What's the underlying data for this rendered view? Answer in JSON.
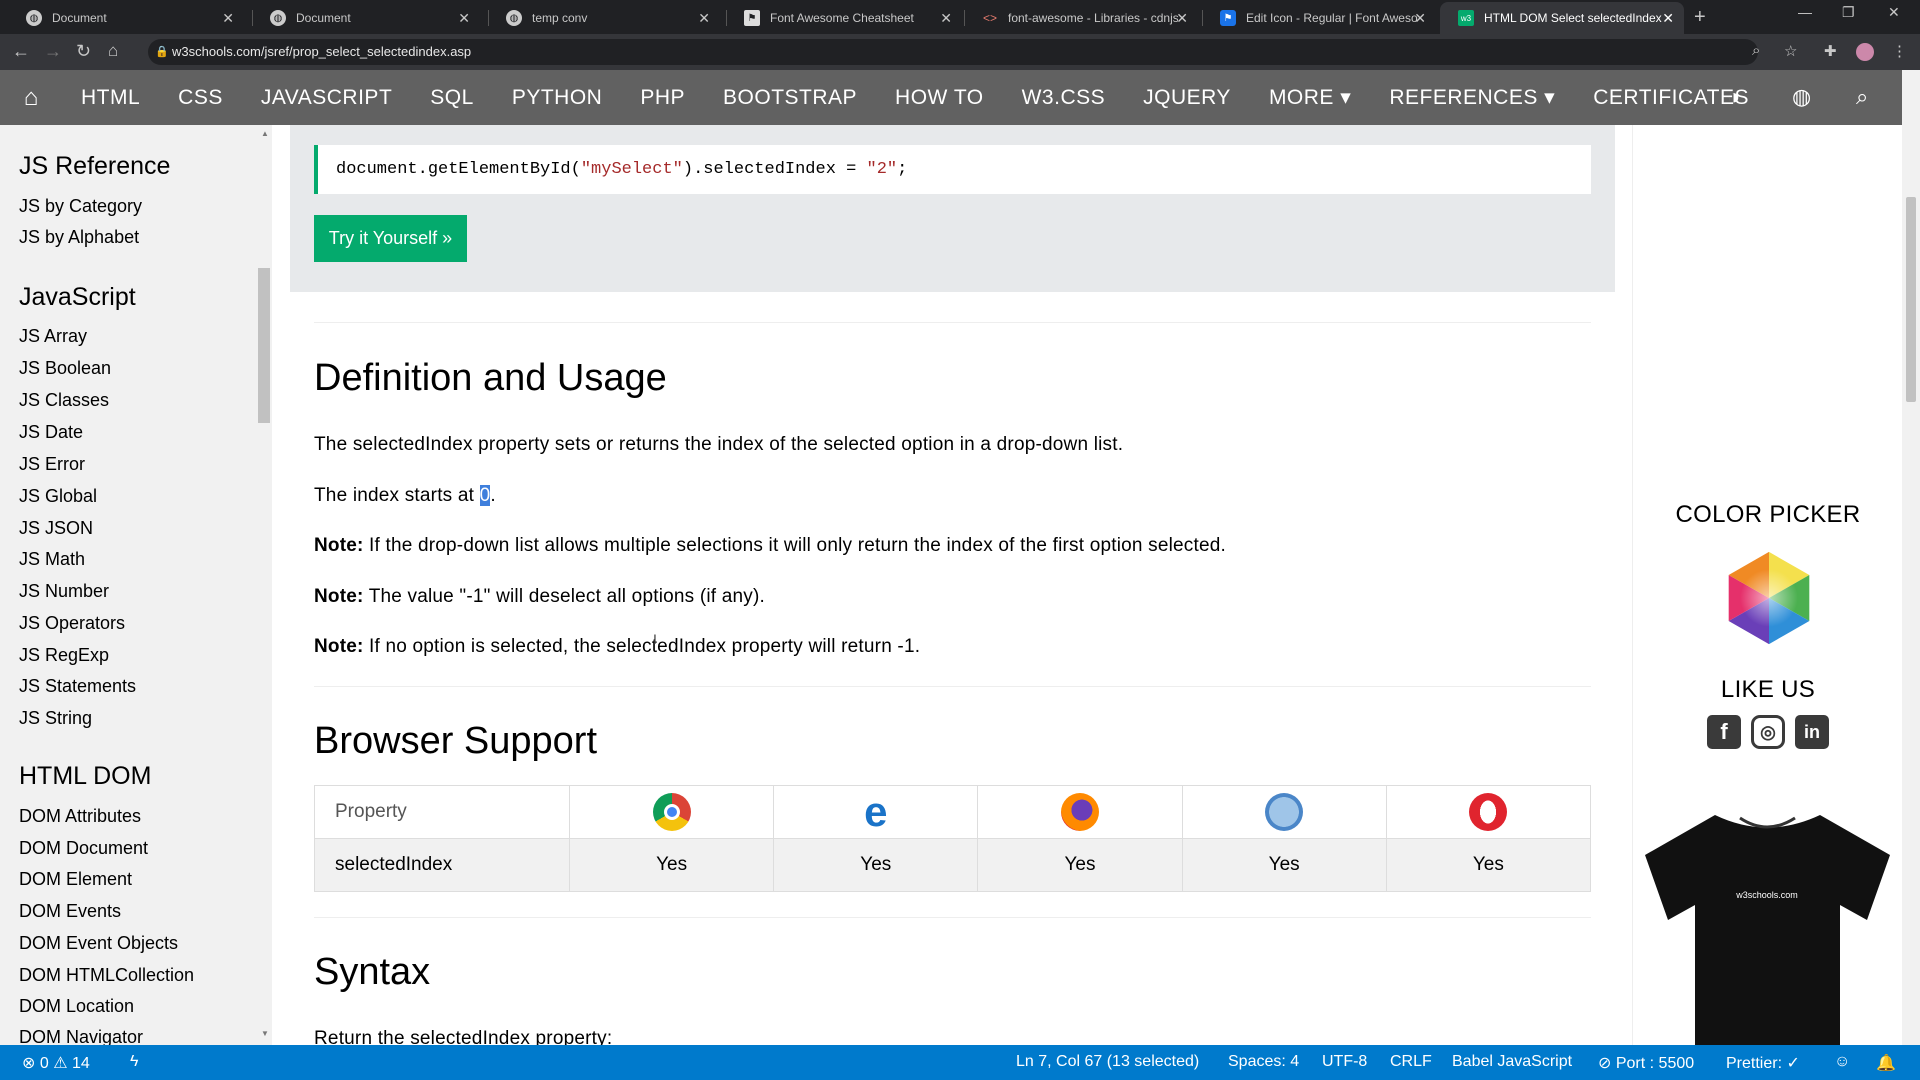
{
  "browser": {
    "tabs": [
      {
        "title": "Document",
        "active": false
      },
      {
        "title": "Document",
        "active": false
      },
      {
        "title": "temp conv",
        "active": false
      },
      {
        "title": "Font Awesome Cheatsheet",
        "active": false
      },
      {
        "title": "font-awesome - Libraries - cdnjs",
        "active": false
      },
      {
        "title": "Edit Icon - Regular | Font Awesome",
        "active": false
      },
      {
        "title": "HTML DOM Select selectedIndex",
        "active": true
      }
    ],
    "url": "w3schools.com/jsref/prop_select_selectedindex.asp"
  },
  "topnav": {
    "items": [
      "HTML",
      "CSS",
      "JAVASCRIPT",
      "SQL",
      "PYTHON",
      "PHP",
      "BOOTSTRAP",
      "HOW TO",
      "W3.CSS",
      "JQUERY",
      "MORE ▾",
      "REFERENCES ▾",
      "CERTIFICATES"
    ]
  },
  "sidebar": {
    "sections": [
      {
        "heading": "JS Reference",
        "items": [
          "JS by Category",
          "JS by Alphabet"
        ]
      },
      {
        "heading": "JavaScript",
        "items": [
          "JS Array",
          "JS Boolean",
          "JS Classes",
          "JS Date",
          "JS Error",
          "JS Global",
          "JS JSON",
          "JS Math",
          "JS Number",
          "JS Operators",
          "JS RegExp",
          "JS Statements",
          "JS String"
        ]
      },
      {
        "heading": "HTML DOM",
        "items": [
          "DOM Attributes",
          "DOM Document",
          "DOM Element",
          "DOM Events",
          "DOM Event Objects",
          "DOM HTMLCollection",
          "DOM Location",
          "DOM Navigator"
        ]
      }
    ]
  },
  "example": {
    "code_prefix": "document.getElementById(",
    "code_arg": "\"mySelect\"",
    "code_mid": ").selectedIndex = ",
    "code_value": "\"2\"",
    "code_suffix": ";",
    "try_button": "Try it Yourself »"
  },
  "definition": {
    "heading": "Definition and Usage",
    "p1": "The selectedIndex property sets or returns the index of the selected option in a drop-down list.",
    "p2_before": "The index starts at ",
    "p2_selected": "0",
    "p2_after": ".",
    "note_label": "Note:",
    "note1": " If the drop-down list allows multiple selections it will only return the index of the first option selected.",
    "note2": " The value \"-1\" will deselect all options (if any).",
    "note3": " If no option is selected, the selectedIndex property will return -1."
  },
  "browser_support": {
    "heading": "Browser Support",
    "header_label": "Property",
    "browsers": [
      "chrome-icon",
      "edge-icon",
      "firefox-icon",
      "safari-icon",
      "opera-icon"
    ],
    "row_label": "selectedIndex",
    "row_values": [
      "Yes",
      "Yes",
      "Yes",
      "Yes",
      "Yes"
    ]
  },
  "syntax": {
    "heading": "Syntax",
    "p1": "Return the selectedIndex property:"
  },
  "rightcol": {
    "color_picker": "COLOR PICKER",
    "like_us": "LIKE US",
    "shirt_text": "w3schools.com"
  },
  "statusbar": {
    "errors": "0",
    "warnings": "14",
    "position": "Ln 7, Col 67 (13 selected)",
    "spaces": "Spaces: 4",
    "encoding": "UTF-8",
    "eol": "CRLF",
    "language": "Babel JavaScript",
    "port": "Port : 5500",
    "prettier": "Prettier: ✓"
  },
  "colors": {
    "w3_green": "#04aa6d",
    "topnav": "#616161",
    "statusbar": "#007acc",
    "selection": "#3f7fdc"
  }
}
